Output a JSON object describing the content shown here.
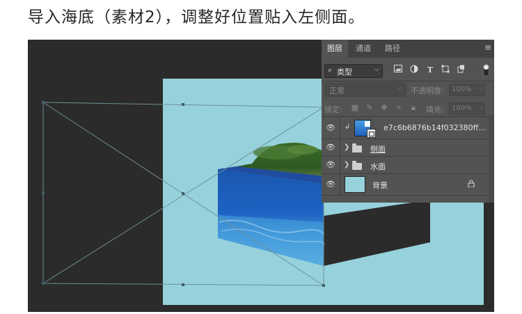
{
  "heading": "导入海底（素材2），调整好位置贴入左侧面。",
  "colors": {
    "workspace": "#2b2b2b",
    "document": "#97d2dc",
    "panel": "#535353",
    "panel_dark": "#424242"
  },
  "layers_panel": {
    "tabs": [
      "图层",
      "通道",
      "路径"
    ],
    "active_tab": "图层",
    "menu_icon": "panel-menu-icon",
    "filter": {
      "label": "类型",
      "icon": "search-icon"
    },
    "filter_icons": [
      "image-filter-icon",
      "adjustment-filter-icon",
      "type-filter-icon",
      "shape-filter-icon",
      "smart-object-filter-icon"
    ],
    "type_icon_glyph": "T",
    "blend_mode": "正常",
    "opacity_label": "不透明度:",
    "opacity_value": "100%",
    "lock_label": "锁定:",
    "fill_label": "填充:",
    "fill_value": "100%",
    "layers": [
      {
        "name": "e7c6b6876b14f032380ff...",
        "kind": "smart-object",
        "clipped": true,
        "visible": true
      },
      {
        "name": "侧面",
        "kind": "group",
        "visible": true
      },
      {
        "name": "水面",
        "kind": "group",
        "visible": true
      },
      {
        "name": "背景",
        "kind": "background",
        "visible": true,
        "locked": true
      }
    ]
  }
}
